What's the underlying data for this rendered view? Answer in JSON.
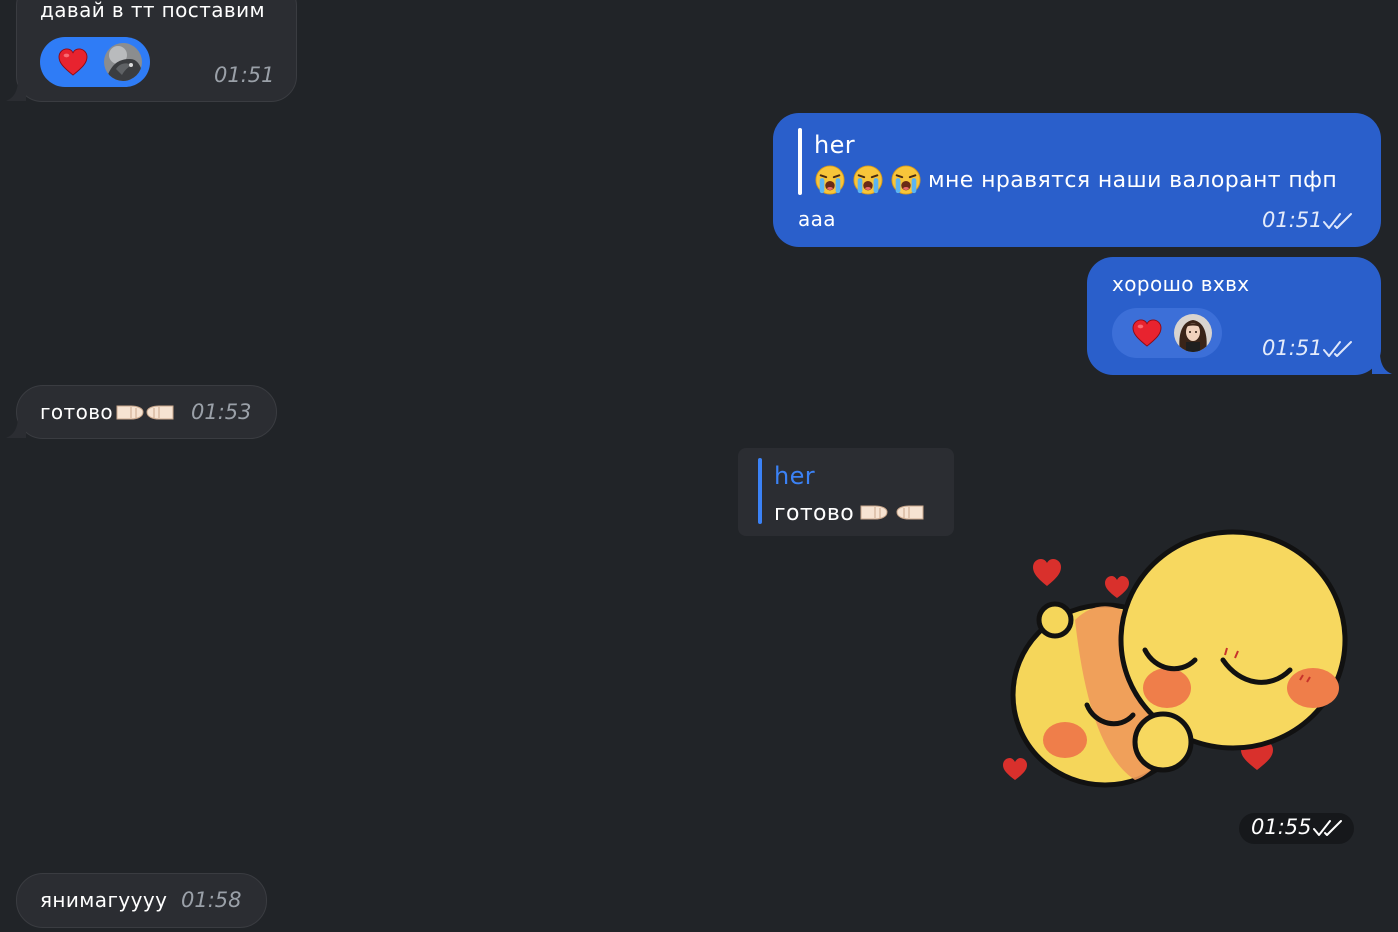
{
  "messages": [
    {
      "text": "давай в тт поставим",
      "time": "01:51",
      "reaction": {
        "emoji_icon": "red-heart-icon",
        "reactor": "dark-cat-avatar"
      }
    },
    {
      "reply_to": {
        "author": "her",
        "text": "мне нравятся наши валорант пфп",
        "emoji_icons": [
          "loudly-crying-face-icon",
          "loudly-crying-face-icon",
          "loudly-crying-face-icon"
        ]
      },
      "text": "ааа",
      "time": "01:51",
      "status_icon": "double-check-icon"
    },
    {
      "text": "хорошо вхвх",
      "time": "01:51",
      "status_icon": "double-check-icon",
      "reaction": {
        "emoji_icon": "red-heart-icon",
        "reactor": "girl-avatar"
      }
    },
    {
      "text": "готово",
      "emoji_icons": [
        "right-facing-fist-icon",
        "left-facing-fist-icon"
      ],
      "time": "01:53"
    },
    {
      "reply_to": {
        "author": "her",
        "text": "готово",
        "emoji_icons": [
          "right-facing-fist-icon",
          "left-facing-fist-icon"
        ]
      },
      "sticker": "hugging-ducks-sticker",
      "time": "01:55",
      "status_icon": "double-check-icon"
    },
    {
      "text": "янимагуууу",
      "time": "01:58"
    }
  ],
  "colors": {
    "background": "#212428",
    "incoming_bubble": "#2b2d32",
    "outgoing_bubble": "#2a5fcb",
    "reply_author_accent": "#3b82f6"
  }
}
